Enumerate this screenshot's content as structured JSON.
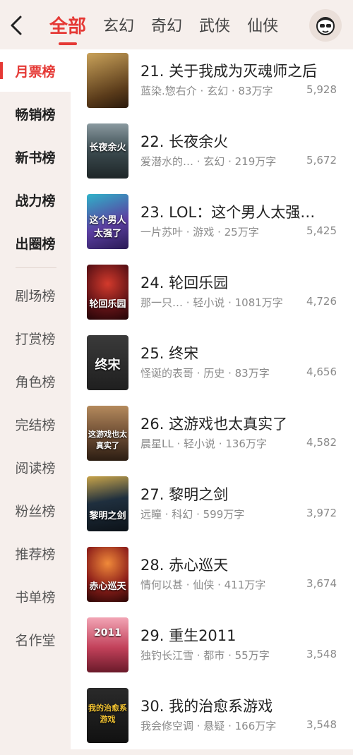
{
  "header": {
    "tabs": [
      {
        "label": "全部",
        "active": true
      },
      {
        "label": "玄幻",
        "active": false
      },
      {
        "label": "奇幻",
        "active": false
      },
      {
        "label": "武侠",
        "active": false
      },
      {
        "label": "仙侠",
        "active": false
      }
    ]
  },
  "sidebar": {
    "items": [
      {
        "label": "月票榜"
      },
      {
        "label": "畅销榜"
      },
      {
        "label": "新书榜"
      },
      {
        "label": "战力榜"
      },
      {
        "label": "出圈榜"
      },
      {
        "label": "剧场榜"
      },
      {
        "label": "打赏榜"
      },
      {
        "label": "角色榜"
      },
      {
        "label": "完结榜"
      },
      {
        "label": "阅读榜"
      },
      {
        "label": "粉丝榜"
      },
      {
        "label": "推荐榜"
      },
      {
        "label": "书单榜"
      },
      {
        "label": "名作堂"
      }
    ]
  },
  "books": [
    {
      "title": "21. 关于我成为灭魂师之后",
      "meta": "蓝染.惣右介 · 玄幻 · 83万字",
      "count": "5,928",
      "cover_text": "",
      "cover_color": "#7a5a2f"
    },
    {
      "title": "22. 长夜余火",
      "meta": "爱潜水的… · 玄幻 · 219万字",
      "count": "5,672",
      "cover_text": "长夜余火",
      "cover_color": "#3b4a4f"
    },
    {
      "title": "23. LOL：这个男人太强…",
      "meta": "一片苏叶 · 游戏 · 25万字",
      "count": "5,425",
      "cover_text": "这个男人太强了",
      "cover_color": "#5b3fa1"
    },
    {
      "title": "24. 轮回乐园",
      "meta": "那一只… · 轻小说 · 1081万字",
      "count": "4,726",
      "cover_text": "轮回乐园",
      "cover_color": "#5e1216"
    },
    {
      "title": "25. 终宋",
      "meta": "怪诞的表哥 · 历史 · 83万字",
      "count": "4,656",
      "cover_text": "终宋",
      "cover_color": "#2b2b2b"
    },
    {
      "title": "26. 这游戏也太真实了",
      "meta": "晨星LL · 轻小说 · 136万字",
      "count": "4,582",
      "cover_text": "这游戏也太真实了",
      "cover_color": "#6a4a32"
    },
    {
      "title": "27. 黎明之剑",
      "meta": "远瞳 · 科幻 · 599万字",
      "count": "3,972",
      "cover_text": "黎明之剑",
      "cover_color": "#1f2f3e"
    },
    {
      "title": "28. 赤心巡天",
      "meta": "情何以甚 · 仙侠 · 411万字",
      "count": "3,674",
      "cover_text": "赤心巡天",
      "cover_color": "#8e1f1a"
    },
    {
      "title": "29. 重生2011",
      "meta": "独钓长江雪 · 都市 · 55万字",
      "count": "3,548",
      "cover_text": "2011",
      "cover_color": "#c2415a"
    },
    {
      "title": "30. 我的治愈系游戏",
      "meta": "我会修空调 · 悬疑 · 166万字",
      "count": "3,548",
      "cover_text": "我的治愈系游戏",
      "cover_color": "#1d1d1d"
    }
  ]
}
